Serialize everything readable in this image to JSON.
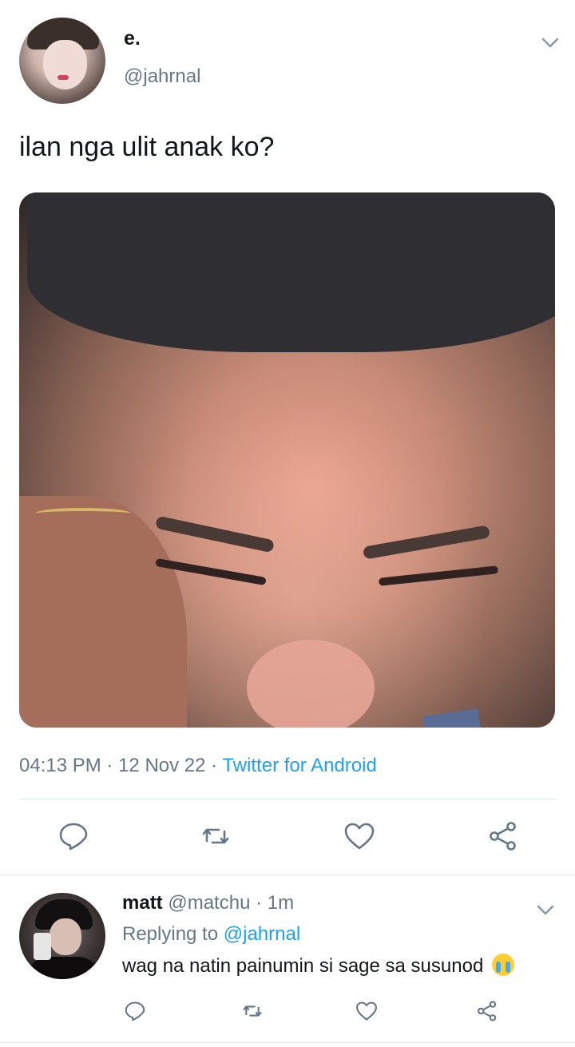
{
  "tweet": {
    "display_name": "e.",
    "handle": "@jahrnal",
    "text": "ilan nga ulit anak ko?",
    "time": "04:13 PM",
    "date": "12 Nov 22",
    "source": "Twitter for Android",
    "sep": "·"
  },
  "reply": {
    "name": "matt",
    "handle": "@matchu",
    "sep": "·",
    "age": "1m",
    "replying_label": "Replying to",
    "replying_to": "@jahrnal",
    "text": "wag na natin painumin si sage sa susunod"
  },
  "icons": {
    "reply": "reply-icon",
    "retweet": "retweet-icon",
    "like": "heart-icon",
    "share": "share-icon",
    "menu": "chevron-down-icon",
    "emoji": "loudly-crying-face"
  },
  "colors": {
    "text": "#14171a",
    "secondary": "#657786",
    "link": "#1da1f2",
    "divider": "#e1e8ed"
  }
}
